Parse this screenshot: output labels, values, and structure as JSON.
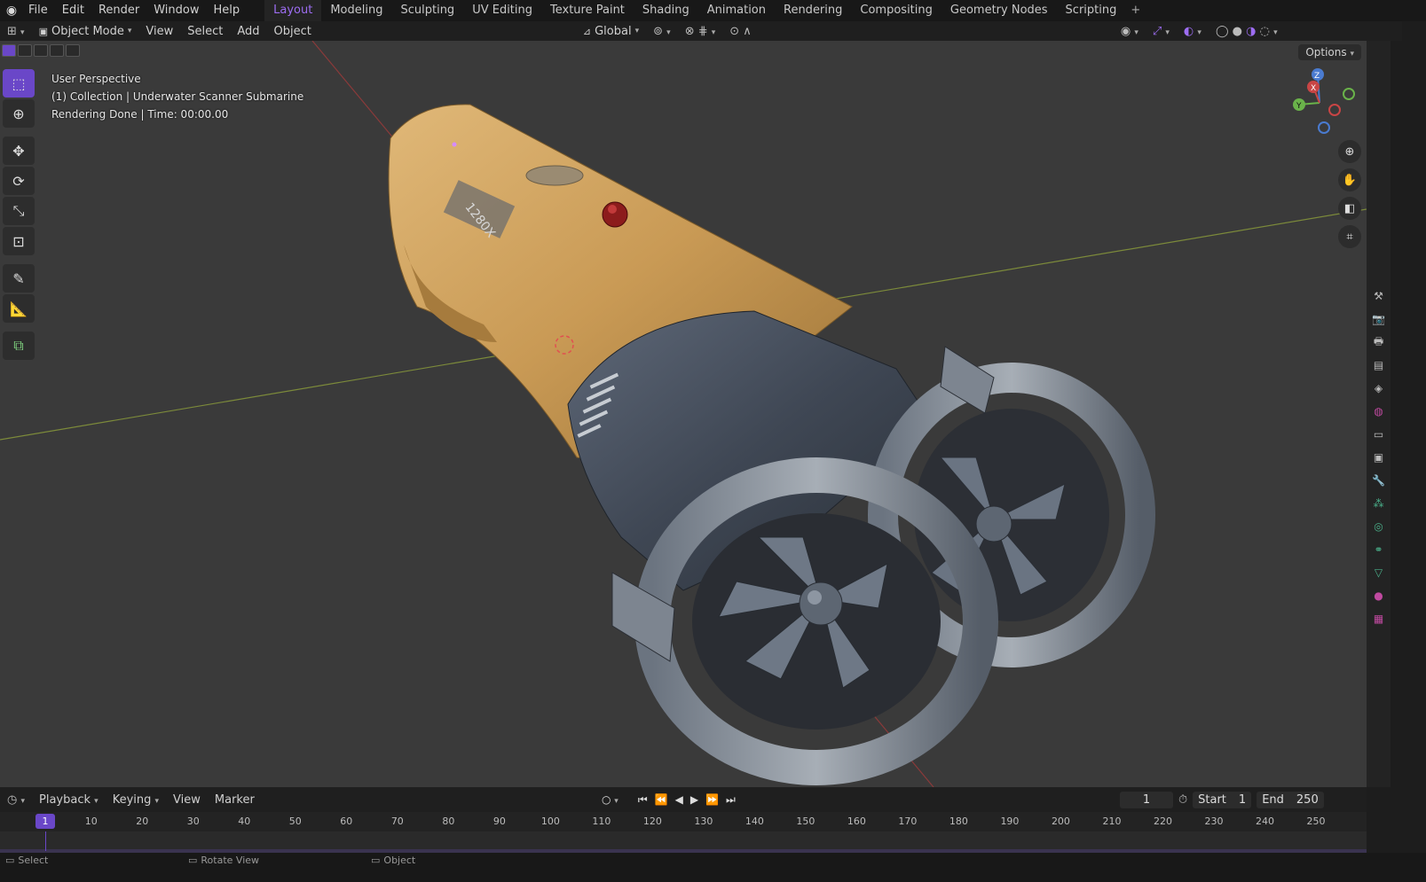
{
  "menu": {
    "items": [
      "File",
      "Edit",
      "Render",
      "Window",
      "Help"
    ]
  },
  "workspaces": {
    "tabs": [
      "Layout",
      "Modeling",
      "Sculpting",
      "UV Editing",
      "Texture Paint",
      "Shading",
      "Animation",
      "Rendering",
      "Compositing",
      "Geometry Nodes",
      "Scripting"
    ],
    "active": "Layout"
  },
  "header": {
    "mode": "Object Mode",
    "menus": [
      "View",
      "Select",
      "Add",
      "Object"
    ],
    "orientation": "Global"
  },
  "viewport": {
    "perspective": "User Perspective",
    "collection": "(1) Collection | Underwater Scanner Submarine",
    "render_status": "Rendering Done | Time: 00:00.00",
    "options_label": "Options",
    "decal_text": "1280X",
    "gizmo": {
      "x": "X",
      "y": "Y",
      "z": "Z"
    }
  },
  "timeline": {
    "menus": [
      "Playback",
      "Keying",
      "View",
      "Marker"
    ],
    "current_frame": "1",
    "start_label": "Start",
    "start_value": "1",
    "end_label": "End",
    "end_value": "250",
    "ruler_marks": [
      "1",
      "10",
      "20",
      "30",
      "40",
      "50",
      "60",
      "70",
      "80",
      "90",
      "100",
      "110",
      "120",
      "130",
      "140",
      "150",
      "160",
      "170",
      "180",
      "190",
      "200",
      "210",
      "220",
      "230",
      "240",
      "250"
    ]
  },
  "statusbar": {
    "items": [
      "Select",
      "Rotate View",
      "Object"
    ]
  },
  "colors": {
    "accent": "#6a47c8",
    "active_tab_text": "#9d6df2",
    "hull": "#c99a55",
    "thruster": "#4a5260"
  }
}
